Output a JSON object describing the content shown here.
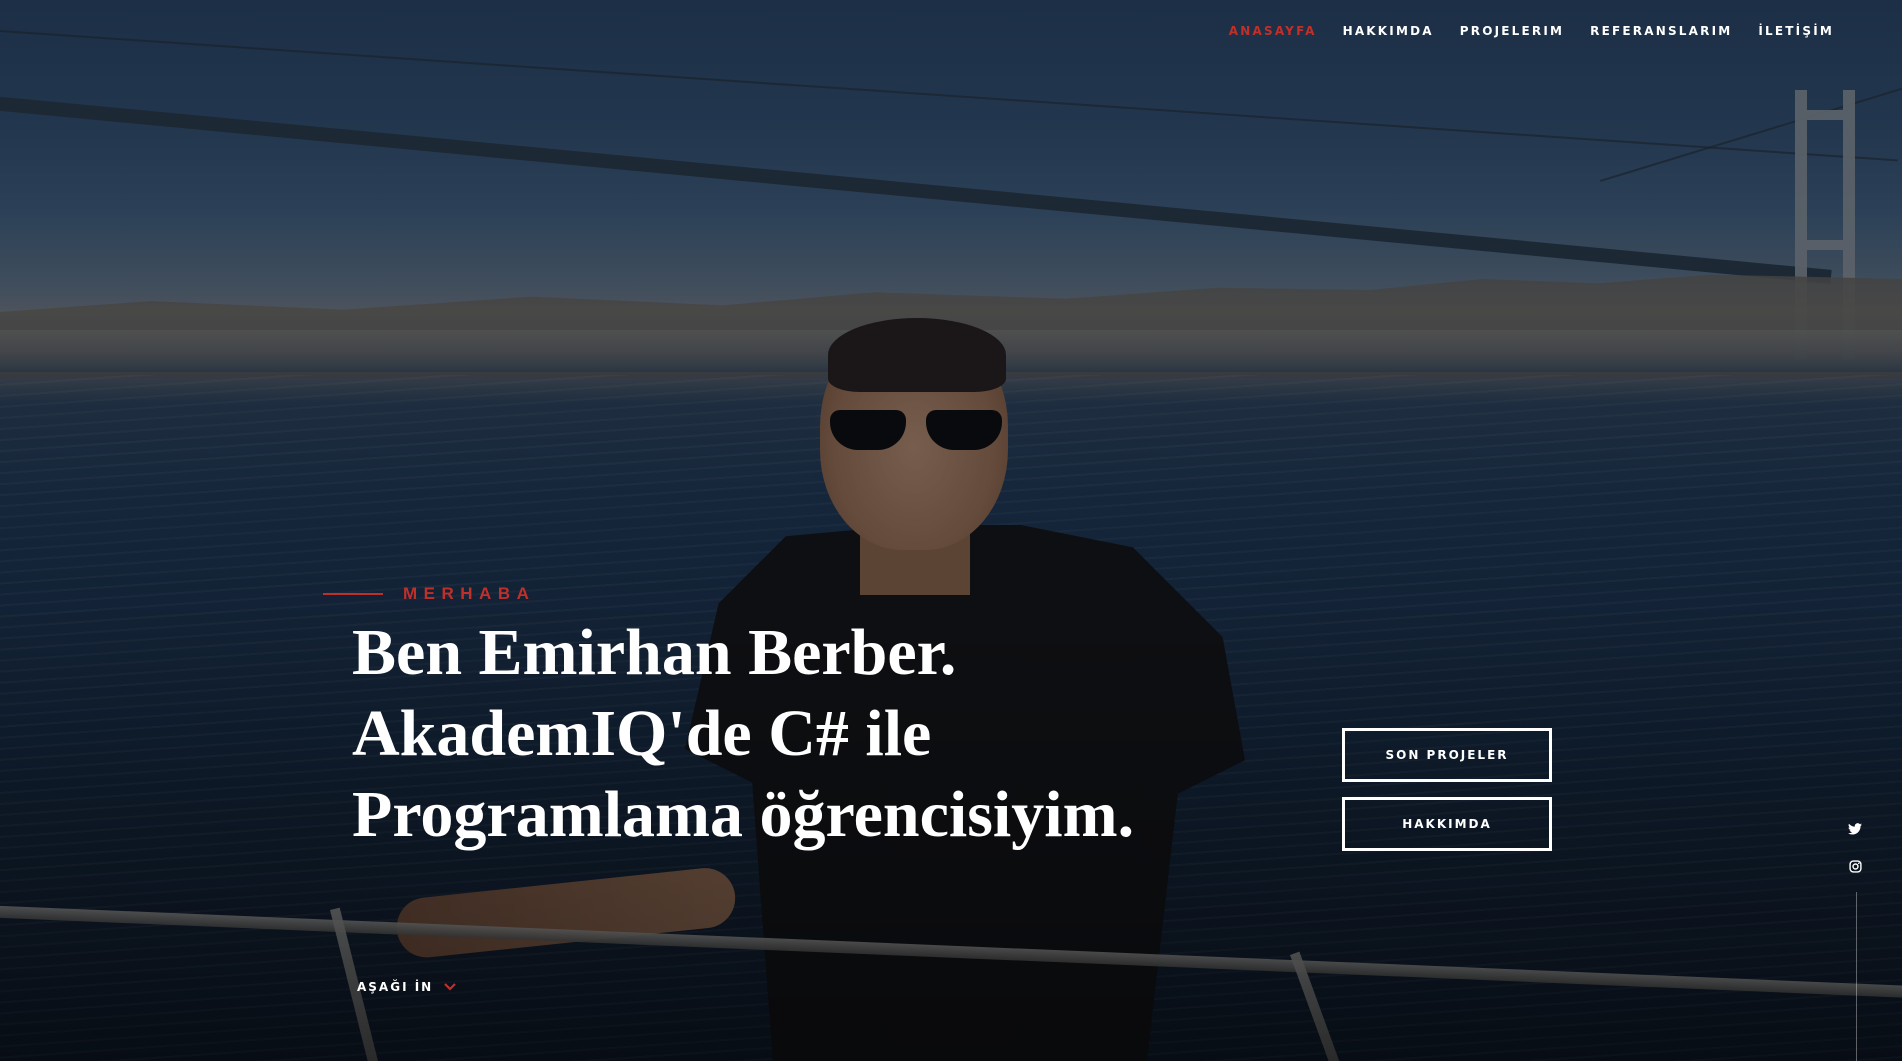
{
  "nav": {
    "items": [
      {
        "label": "ANASAYFA",
        "active": true
      },
      {
        "label": "HAKKIMDA",
        "active": false
      },
      {
        "label": "PROJELERIM",
        "active": false
      },
      {
        "label": "REFERANSLARIM",
        "active": false
      },
      {
        "label": "İLETİŞİM",
        "active": false
      }
    ]
  },
  "hero": {
    "intro": "MERHABA",
    "headline_lines": [
      "Ben Emirhan Berber.",
      "AkademIQ'de C# ile",
      "Programlama öğrencisiyim."
    ],
    "buttons": {
      "projects_label": "SON PROJELER",
      "about_label": "HAKKIMDA"
    },
    "scroll_label": "AŞAĞI İN"
  },
  "social": {
    "icons": [
      "twitter-icon",
      "instagram-icon"
    ]
  },
  "colors": {
    "accent": "#c0302a",
    "text": "#ffffff"
  }
}
